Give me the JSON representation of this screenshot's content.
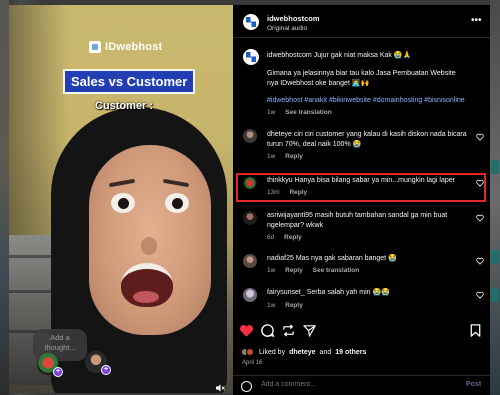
{
  "video": {
    "brand_logo": "IDwebhost",
    "title": "Sales vs Customer",
    "caption": "Customer :",
    "thought_placeholder": "Add a thought..."
  },
  "post": {
    "username": "idwebhostcom",
    "audio": "Original audio",
    "caption_user": "idwebhostcom",
    "caption_line1": "Jujur gak niat maksa Kak 😭🙏",
    "caption_line2": "Gimana ya jelasinnya biar tau kalo Jasa Pembuatan Website nya IDwebhost oke banget 👩‍💻🙌",
    "hashtags": "#idwebhost #anakit #bikinwebsite #domainhosting #bisnisonline",
    "caption_time": "1w",
    "see_translation": "See translation"
  },
  "comments": [
    {
      "user": "dheteye",
      "text": "ciri ciri customer yang kalau di kasih diskon nada bicara turun 70%, deal naik 100% 😭",
      "time": "1w",
      "reply": "Reply",
      "see_translation": ""
    },
    {
      "user": "thinkkyu",
      "text": "Hanya bisa bilang sabar ya min...mungkin lagi laper",
      "time": "13m",
      "reply": "Reply",
      "see_translation": ""
    },
    {
      "user": "asriwijayanti95",
      "text": "masih butuh tambahan sandal ga min buat ngelempar? wkwk",
      "time": "6d",
      "reply": "Reply",
      "see_translation": ""
    },
    {
      "user": "nadiaf25",
      "text": "Mas nya gak sabaran banget 😭",
      "time": "1w",
      "reply": "Reply",
      "see_translation": "See translation"
    },
    {
      "user": "fairysunset_",
      "text": "Serba salah yah min 😭😭",
      "time": "1w",
      "reply": "Reply",
      "see_translation": ""
    }
  ],
  "likes": {
    "prefix": "Liked by",
    "first_user": "dheteye",
    "connector": "and",
    "others": "19 others"
  },
  "date": "April 16",
  "add_comment": {
    "placeholder": "Add a comment...",
    "post_label": "Post"
  },
  "icons": {
    "like": "heart-icon",
    "comment": "comment-icon",
    "repost": "repost-icon",
    "share": "share-icon",
    "save": "bookmark-icon"
  },
  "colors": {
    "like_active": "#ff3040",
    "link": "#8bb3ff",
    "highlight_border": "#e0262b"
  }
}
